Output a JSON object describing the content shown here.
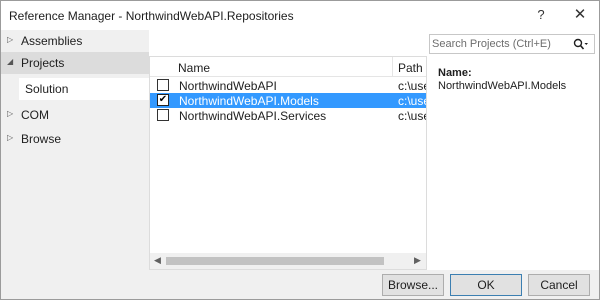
{
  "window": {
    "title": "Reference Manager - NorthwindWebAPI.Repositories",
    "help_label": "?",
    "close_label": "✕"
  },
  "sidebar": {
    "items": [
      {
        "label": "Assemblies",
        "arrow": "▷"
      },
      {
        "label": "Projects",
        "arrow": "◢"
      },
      {
        "label": "COM",
        "arrow": "▷"
      },
      {
        "label": "Browse",
        "arrow": "▷"
      }
    ],
    "subitems": [
      {
        "label": "Solution"
      }
    ]
  },
  "list": {
    "columns": [
      "Name",
      "Path"
    ],
    "rows": [
      {
        "name": "NorthwindWebAPI",
        "path": "c:\\user",
        "checked": false,
        "check_mark": ""
      },
      {
        "name": "NorthwindWebAPI.Models",
        "path": "c:\\user",
        "checked": true,
        "check_mark": "✔"
      },
      {
        "name": "NorthwindWebAPI.Services",
        "path": "c:\\user",
        "checked": false,
        "check_mark": ""
      }
    ],
    "scroll_left": "◀",
    "scroll_right": "▶"
  },
  "search": {
    "placeholder": "Search Projects (Ctrl+E)",
    "value": "",
    "icon": "search-icon"
  },
  "details": {
    "name_label": "Name:",
    "name_value": "NorthwindWebAPI.Models"
  },
  "buttons": {
    "browse": "Browse...",
    "ok": "OK",
    "cancel": "Cancel"
  },
  "colors": {
    "selection": "#3399ff",
    "sidebar_bg": "#f0f0f0",
    "default_button_border": "#3c7fb1"
  }
}
